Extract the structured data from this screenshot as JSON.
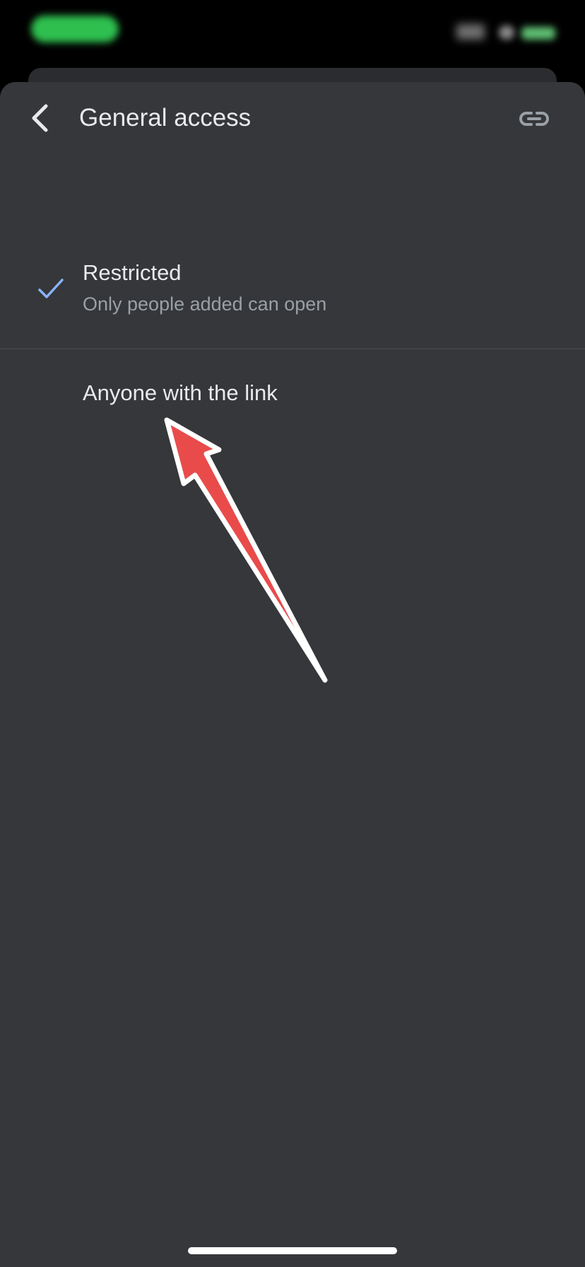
{
  "status_bar": {
    "time_pill_color": "#2ebf4f"
  },
  "header": {
    "title": "General access",
    "back_icon": "chevron-left-icon",
    "link_icon": "link-icon"
  },
  "options": [
    {
      "label": "Restricted",
      "description": "Only people added can open",
      "selected": true,
      "icon": "check-icon"
    },
    {
      "label": "Anyone with the link",
      "selected": false
    }
  ],
  "colors": {
    "sheet_background": "#35373a",
    "check_accent": "#8ab4f8",
    "annotation_arrow": "#e94b4b"
  }
}
